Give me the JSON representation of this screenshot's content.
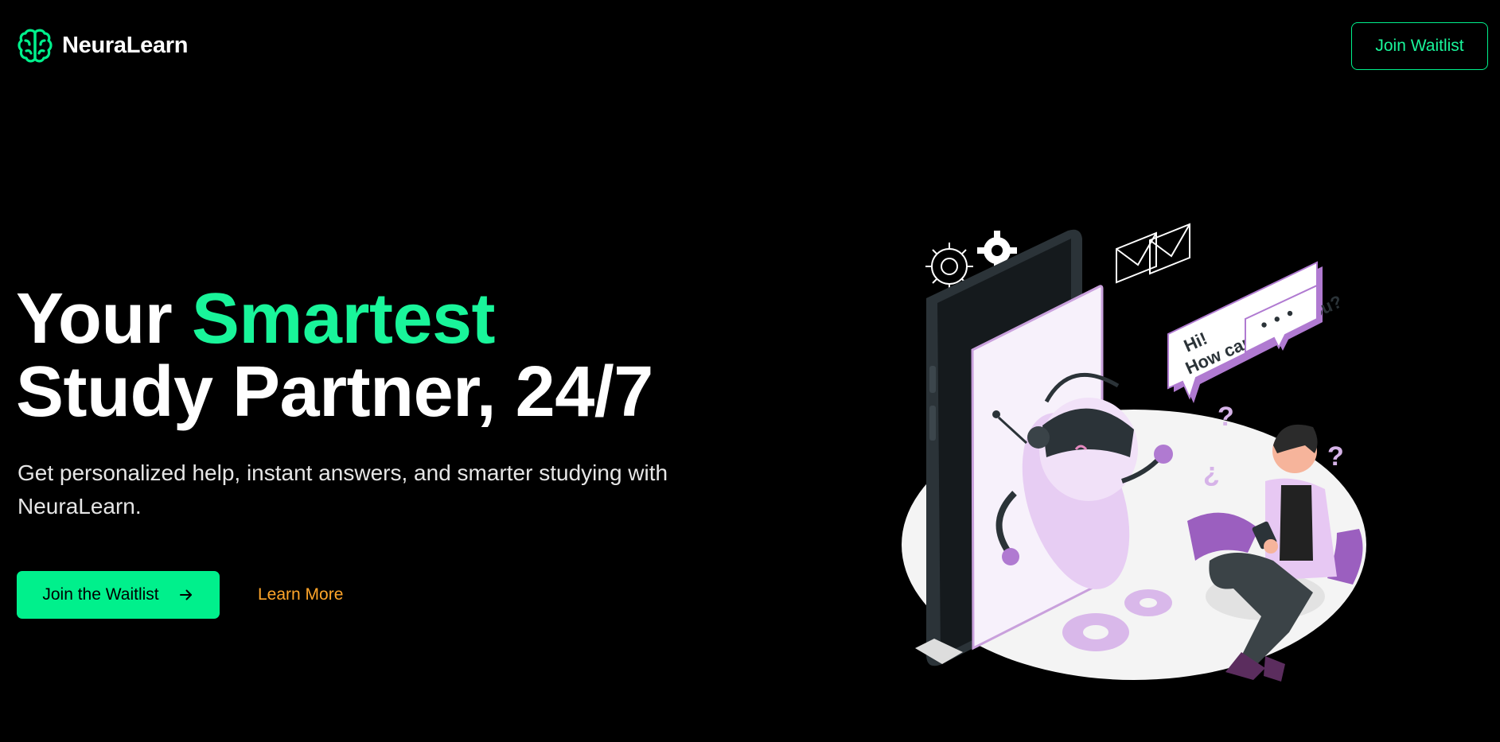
{
  "brand": {
    "name": "NeuraLearn",
    "icon": "brain-icon",
    "accent_color": "#00f08c"
  },
  "header": {
    "cta_label": "Join Waitlist"
  },
  "hero": {
    "title_line1_plain": "Your ",
    "title_line1_accent": "Smartest",
    "title_line2": "Study Partner, 24/7",
    "subtitle": "Get personalized help, instant answers, and smarter studying with NeuraLearn.",
    "primary_cta": "Join the Waitlist",
    "primary_cta_icon": "arrow-right-icon",
    "secondary_cta": "Learn More",
    "secondary_color": "#ffa52a"
  },
  "illustration": {
    "speech_line1": "Hi!",
    "speech_line2": "How can I help you?",
    "typing_dots": "• • •",
    "question_marks": [
      "?",
      "¿",
      "?"
    ],
    "illustration_accent": "#c9a0dc"
  }
}
